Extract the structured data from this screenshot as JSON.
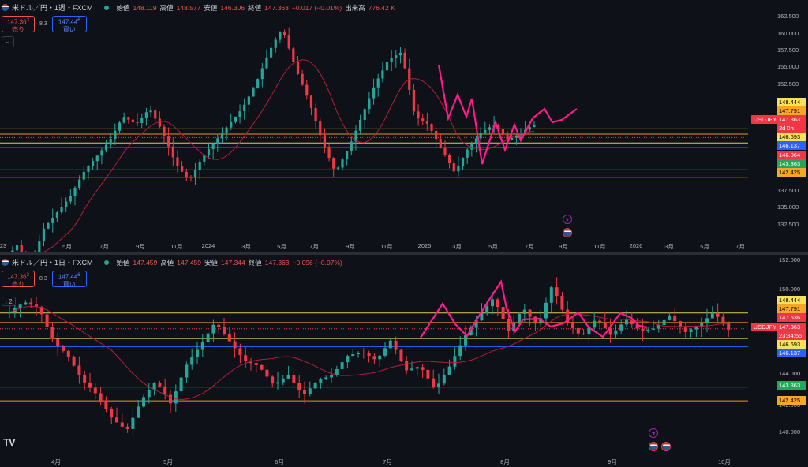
{
  "top": {
    "title": "米ドル／円・1週・FXCM",
    "ohlc": [
      {
        "label": "始値",
        "value": "148.119"
      },
      {
        "label": "高値",
        "value": "148.577"
      },
      {
        "label": "安値",
        "value": "146.306"
      },
      {
        "label": "終値",
        "value": "147.363"
      }
    ],
    "change": "−0.017 (−0.01%)",
    "volume_label": "出来高",
    "volume": "776.42 K",
    "sell_price": "147.36",
    "sell_sup": "3",
    "sell_label": "売り",
    "spread": "8.3",
    "buy_price": "147.44",
    "buy_sup": "6",
    "buy_label": "買い",
    "collapse_icon": "⌄",
    "y_ticks": [
      "162.500",
      "160.000",
      "157.500",
      "155.000",
      "152.500",
      "137.500",
      "135.000",
      "132.500"
    ],
    "x_ticks": [
      "23",
      "5月",
      "7月",
      "9月",
      "11月",
      "2024",
      "3月",
      "5月",
      "7月",
      "9月",
      "11月",
      "2025",
      "3月",
      "5月",
      "7月",
      "9月",
      "11月",
      "2026",
      "3月",
      "5月",
      "7月"
    ],
    "price_tags": [
      {
        "text": "148.444",
        "bg": "#f7e15a",
        "fg": "#000000"
      },
      {
        "text": "147.791",
        "bg": "#f5a623",
        "fg": "#000000"
      },
      {
        "text": "147.363",
        "bg": "#f23645",
        "fg": "#ffffff"
      },
      {
        "text": "2d 0h",
        "bg": "#f23645",
        "fg": "#ffffff"
      },
      {
        "text": "146.693",
        "bg": "#f7e15a",
        "fg": "#000000"
      },
      {
        "text": "146.137",
        "bg": "#2962ff",
        "fg": "#ffffff"
      },
      {
        "text": "146.064",
        "bg": "#f23645",
        "fg": "#ffffff"
      },
      {
        "text": "143.363",
        "bg": "#26a65b",
        "fg": "#ffffff"
      },
      {
        "text": "142.425",
        "bg": "#f5a623",
        "fg": "#000000"
      }
    ],
    "symbol_tag": "USDJPY"
  },
  "bottom": {
    "title": "米ドル／円・1日・FXCM",
    "ohlc": [
      {
        "label": "始値",
        "value": "147.459"
      },
      {
        "label": "高値",
        "value": "147.459"
      },
      {
        "label": "安値",
        "value": "147.344"
      },
      {
        "label": "終値",
        "value": "147.363"
      }
    ],
    "change": "−0.096 (−0.07%)",
    "sell_price": "147.36",
    "sell_sup": "3",
    "sell_label": "売り",
    "spread": "8.3",
    "buy_price": "147.44",
    "buy_sup": "6",
    "buy_label": "買い",
    "collapse_label": "2",
    "y_ticks": [
      "152.000",
      "150.000",
      "144.000",
      "142.000",
      "140.000"
    ],
    "x_ticks": [
      "4月",
      "5月",
      "6月",
      "7月",
      "8月",
      "9月",
      "10月"
    ],
    "price_tags": [
      {
        "text": "148.444",
        "bg": "#f7e15a",
        "fg": "#000000"
      },
      {
        "text": "147.791",
        "bg": "#f5a623",
        "fg": "#000000"
      },
      {
        "text": "147.536",
        "bg": "#f23645",
        "fg": "#ffffff"
      },
      {
        "text": "147.363",
        "bg": "#f23645",
        "fg": "#ffffff"
      },
      {
        "text": "23:34:55",
        "bg": "#f23645",
        "fg": "#ffffff"
      },
      {
        "text": "146.693",
        "bg": "#f7e15a",
        "fg": "#000000"
      },
      {
        "text": "146.137",
        "bg": "#2962ff",
        "fg": "#ffffff"
      },
      {
        "text": "143.363",
        "bg": "#26a65b",
        "fg": "#ffffff"
      },
      {
        "text": "142.425",
        "bg": "#f5a623",
        "fg": "#000000"
      }
    ],
    "symbol_tag": "USDJPY"
  },
  "logo": "TV",
  "colors": {
    "up": "#26a69a",
    "down": "#f23645",
    "ma": "#b71c3a",
    "zigzag": "#ff1a8c",
    "bg": "#0e1118"
  }
}
